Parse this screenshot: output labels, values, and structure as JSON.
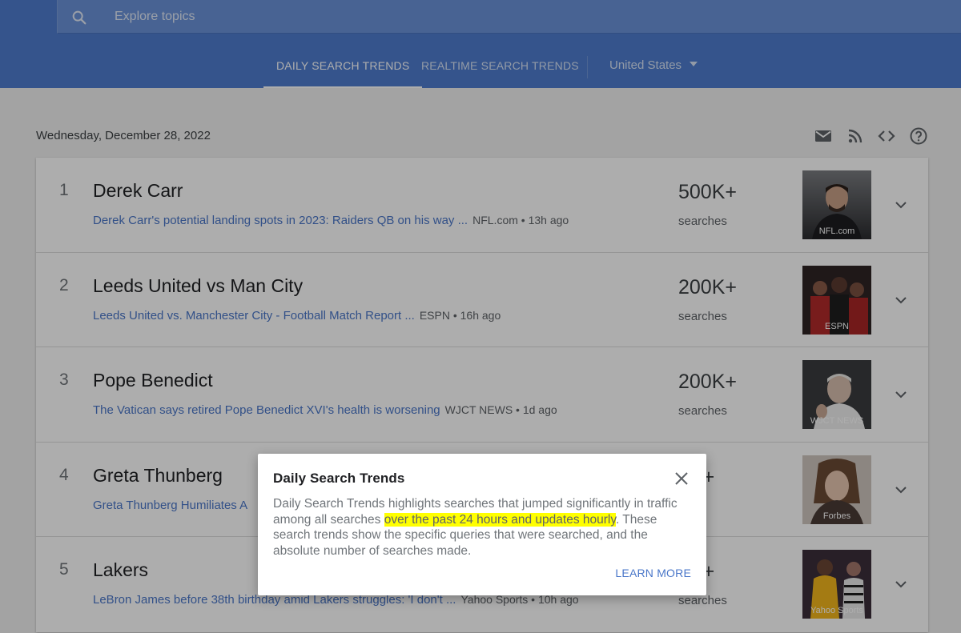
{
  "header": {
    "search_placeholder": "Explore topics",
    "tabs": [
      {
        "label": "DAILY SEARCH TRENDS",
        "active": true
      },
      {
        "label": "REALTIME SEARCH TRENDS",
        "active": false
      }
    ],
    "country": "United States"
  },
  "date": "Wednesday, December 28, 2022",
  "toolbar_icons": [
    "email-icon",
    "rss-icon",
    "embed-code-icon",
    "help-icon"
  ],
  "trends": [
    {
      "rank": "1",
      "title": "Derek Carr",
      "article": "Derek Carr's potential landing spots in 2023: Raiders QB on his way ...",
      "source": "NFL.com • 13h ago",
      "count": "500K+",
      "count_label": "searches",
      "image_caption": "NFL.com"
    },
    {
      "rank": "2",
      "title": "Leeds United vs Man City",
      "article": "Leeds United vs. Manchester City - Football Match Report ...",
      "source": "ESPN • 16h ago",
      "count": "200K+",
      "count_label": "searches",
      "image_caption": "ESPN"
    },
    {
      "rank": "3",
      "title": "Pope Benedict",
      "article": "The Vatican says retired Pope Benedict XVI's health is worsening",
      "source": "WJCT NEWS • 1d ago",
      "count": "200K+",
      "count_label": "searches",
      "image_caption": "WJCT NEWS"
    },
    {
      "rank": "4",
      "title": "Greta Thunberg",
      "article": "Greta Thunberg Humiliates A",
      "source": "",
      "count": "0K+",
      "count_label": "hes",
      "image_caption": "Forbes"
    },
    {
      "rank": "5",
      "title": "Lakers",
      "article": "LeBron James before 38th birthday amid Lakers struggles: 'I don't ...",
      "source": "Yahoo Sports • 10h ago",
      "count": "0K+",
      "count_label": "searches",
      "image_caption": "Yahoo Sports"
    }
  ],
  "dialog": {
    "title": "Daily Search Trends",
    "body_before": "Daily Search Trends highlights searches that jumped significantly in traffic among all searches ",
    "body_highlight": "over the past 24 hours and updates hourly",
    "body_after": ". These search trends show the specific queries that were searched, and the absolute number of searches made.",
    "learn_more": "LEARN MORE"
  },
  "colors": {
    "header_bg": "#4e7dcf",
    "link": "#4a77c9",
    "highlight": "#ffff00"
  }
}
